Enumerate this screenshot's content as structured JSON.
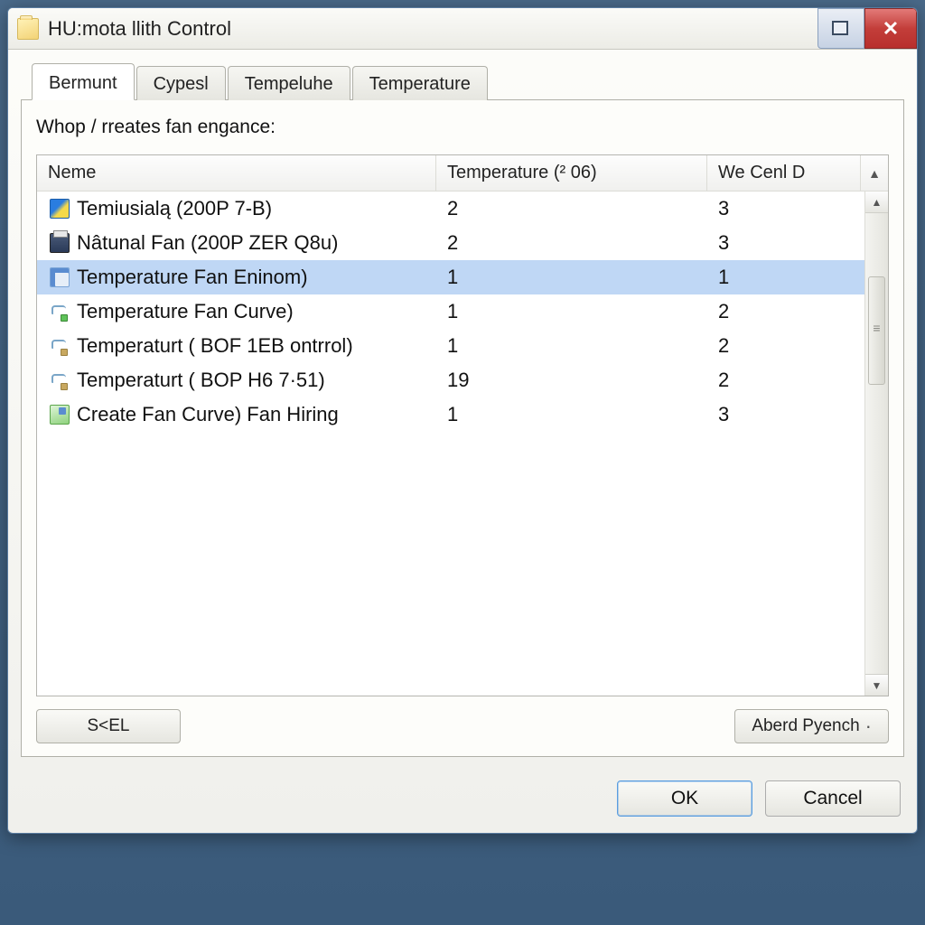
{
  "window": {
    "title": "HU:mota llith Control"
  },
  "tabs": [
    "Bermunt",
    "Cypesl",
    "Tempeluhe",
    "Temperature"
  ],
  "active_tab_index": 0,
  "prompt": "Whop / rreates fan engance:",
  "columns": {
    "c1": "Neme",
    "c2": "Temperature (² 06)",
    "c3": "We Cenl D"
  },
  "rows": [
    {
      "icon": "ic-img",
      "name": "Temiusialą (200P 7-B)",
      "temp": "2",
      "we": "3",
      "selected": false
    },
    {
      "icon": "ic-printer",
      "name": "Nâtunal Fan (200P ZER Q8u)",
      "temp": "2",
      "we": "3",
      "selected": false
    },
    {
      "icon": "ic-grid",
      "name": "Temperature Fan Eninom)",
      "temp": "1",
      "we": "1",
      "selected": true
    },
    {
      "icon": "ic-tap",
      "name": "Temperature Fan Curve)",
      "temp": "1",
      "we": "2",
      "selected": false
    },
    {
      "icon": "ic-tap ic-tap2",
      "name": "Temperaturt ( BOF 1EB ontrrol)",
      "temp": "1",
      "we": "2",
      "selected": false
    },
    {
      "icon": "ic-tap ic-tap2",
      "name": "Temperaturt ( BOP H6 7·51)",
      "temp": "19",
      "we": "2",
      "selected": false
    },
    {
      "icon": "ic-app",
      "name": "Create Fan Curve) Fan Hiring",
      "temp": "1",
      "we": "3",
      "selected": false
    }
  ],
  "buttons": {
    "skel": "S<EL",
    "aberd": "Aberd Pyench",
    "ok": "OK",
    "cancel": "Cancel"
  }
}
